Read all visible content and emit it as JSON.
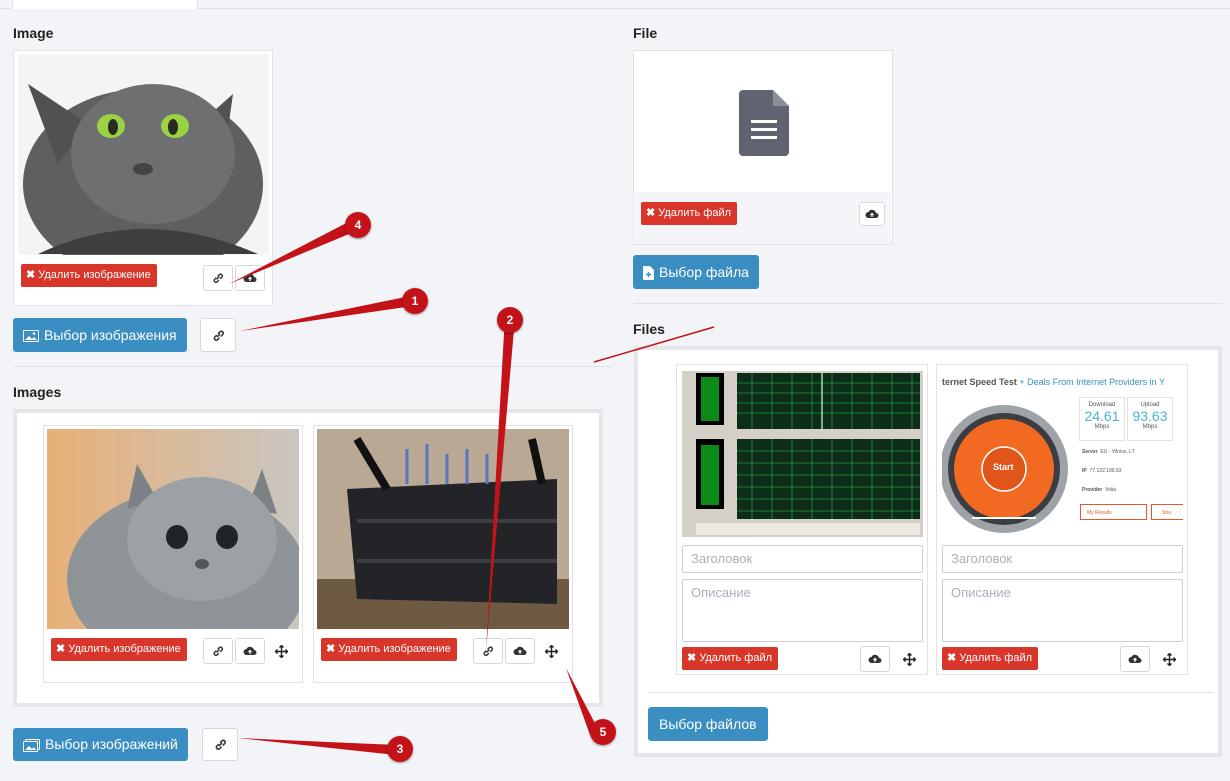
{
  "sections": {
    "image_label": "Image",
    "file_label": "File",
    "images_label": "Images",
    "files_label": "Files"
  },
  "buttons": {
    "delete_image": "Удалить изображение",
    "delete_file": "Удалить файл",
    "choose_image": "Выбор изображения",
    "choose_file": "Выбор файла",
    "choose_images": "Выбор изображений",
    "choose_files": "Выбор файлов"
  },
  "files_list": {
    "title_placeholder": "Заголовок",
    "description_placeholder": "Описание"
  },
  "speedtest_thumb": {
    "header_strong": "ternet Speed Test",
    "header_rest": " + Deals From Internet Providers in Y",
    "start": "Start",
    "download_label": "Download",
    "download_value": "24.61",
    "upload_label": "Upload",
    "upload_value": "93.63",
    "unit": "Mbps",
    "server_label": "Server",
    "server_value": "EU - Vilnius, LT",
    "ip_label": "IP",
    "ip_value": "77.122.199.93",
    "provider_label": "Provider",
    "provider_value": "Volia",
    "my_results": "My Results",
    "share": "Sha"
  },
  "annotations": [
    "1",
    "2",
    "3",
    "4",
    "5"
  ],
  "colors": {
    "danger": "#d9362b",
    "primary": "#3b8ec2",
    "annotation": "#c41318"
  }
}
